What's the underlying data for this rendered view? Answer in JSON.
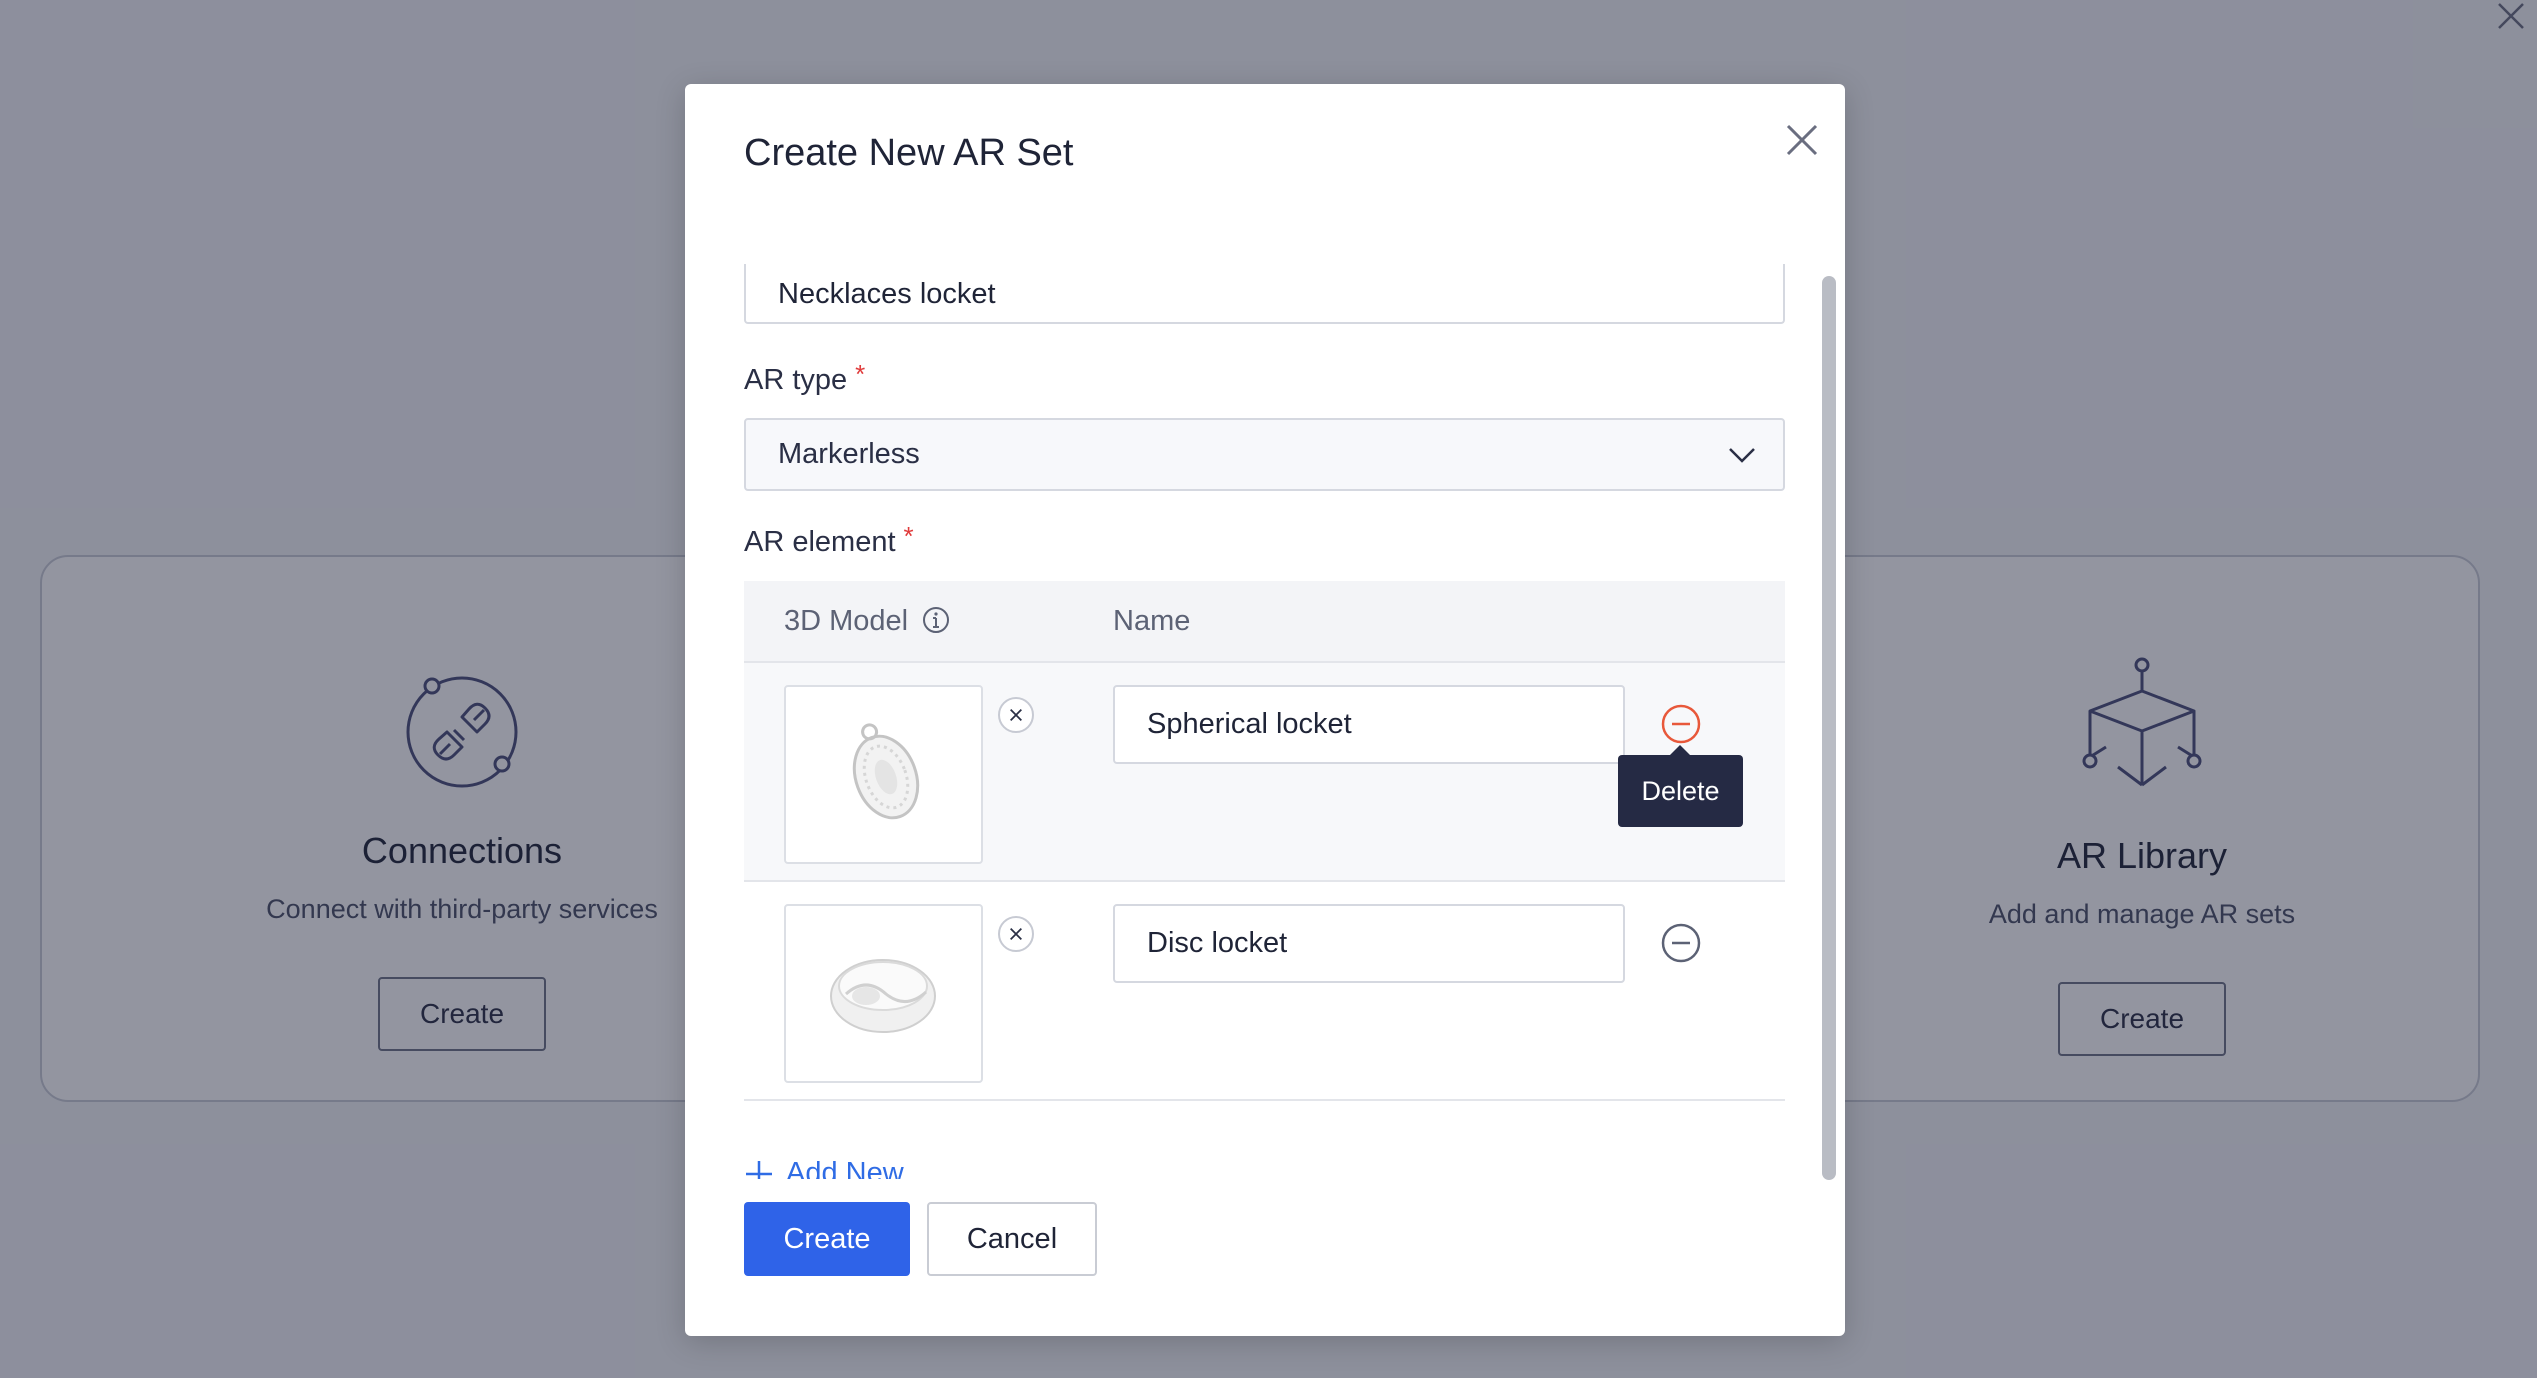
{
  "background": {
    "cards": [
      {
        "title": "Connections",
        "description": "Connect with third-party services",
        "button": "Create",
        "icon": "plug-connection-icon"
      },
      {
        "title": "AR Library",
        "description": "Add and manage AR sets",
        "button": "Create",
        "icon": "3d-cube-icon"
      }
    ]
  },
  "modal": {
    "title": "Create New AR Set",
    "set_name_value": "Necklaces locket",
    "ar_type": {
      "label": "AR type",
      "required_mark": "*",
      "selected": "Markerless"
    },
    "ar_element": {
      "label": "AR element",
      "required_mark": "*",
      "columns": [
        "3D Model",
        "Name"
      ],
      "rows": [
        {
          "model": "spherical-locket-thumbnail",
          "name": "Spherical locket",
          "tooltip": "Delete"
        },
        {
          "model": "disc-locket-thumbnail",
          "name": "Disc locket"
        }
      ]
    },
    "add_new_label": "Add New",
    "create_label": "Create",
    "cancel_label": "Cancel"
  },
  "colors": {
    "primary": "#2f63e8",
    "link": "#2f6ce5",
    "danger": "#e8583a",
    "required": "#e03b3b",
    "tooltip_bg": "#252a44"
  }
}
